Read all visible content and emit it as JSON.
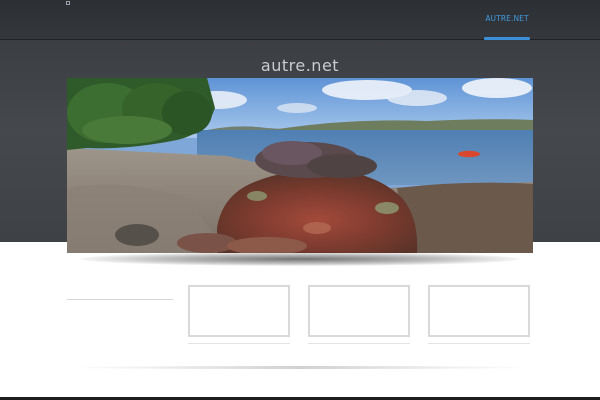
{
  "nav": {
    "link_label": "AUTRE.NET",
    "accent_color": "#3a8fd8"
  },
  "hero": {
    "title": "autre.net",
    "image_description_icon": "coastal-landscape-photo"
  },
  "cards": [
    {
      "name": "card-1"
    },
    {
      "name": "card-2"
    },
    {
      "name": "card-3"
    }
  ],
  "colors": {
    "navbar": "#2f3236",
    "hero_band": "#43464a",
    "card_border": "#d9d9d9",
    "link": "#3f9be0"
  }
}
